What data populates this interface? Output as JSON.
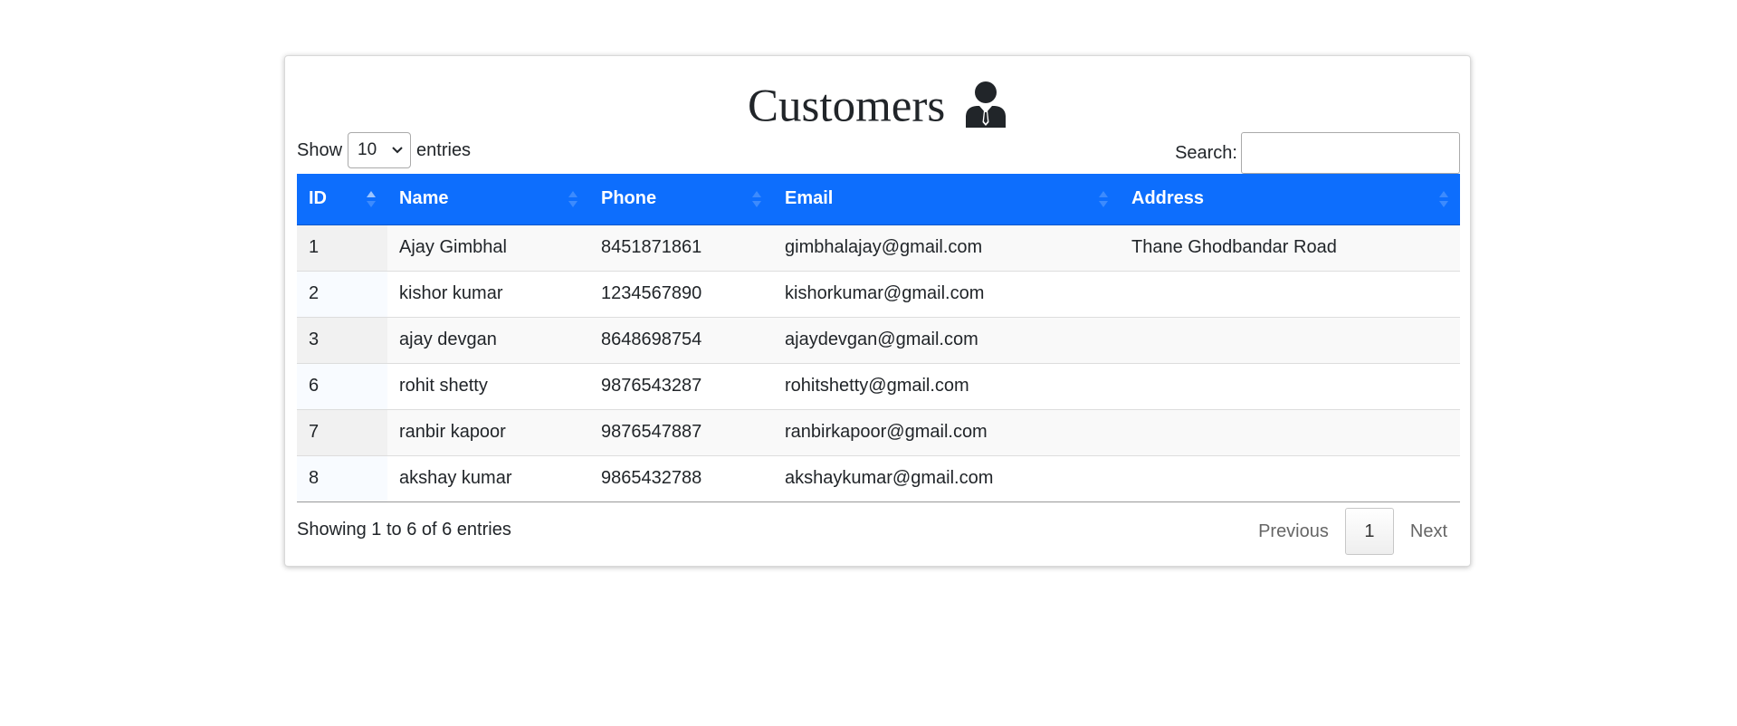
{
  "page": {
    "title": "Customers",
    "title_icon": "user-tie-icon"
  },
  "controls": {
    "show_label": "Show",
    "page_length": "10",
    "entries_label": "entries",
    "search_label": "Search:",
    "search_value": ""
  },
  "table": {
    "columns": [
      "ID",
      "Name",
      "Phone",
      "Email",
      "Address"
    ],
    "sorted_column": "ID",
    "sort_direction": "ascending",
    "rows": [
      {
        "id": "1",
        "name": "Ajay Gimbhal",
        "phone": "8451871861",
        "email": "gimbhalajay@gmail.com",
        "address": "Thane Ghodbandar Road"
      },
      {
        "id": "2",
        "name": "kishor kumar",
        "phone": "1234567890",
        "email": "kishorkumar@gmail.com",
        "address": ""
      },
      {
        "id": "3",
        "name": "ajay devgan",
        "phone": "8648698754",
        "email": "ajaydevgan@gmail.com",
        "address": ""
      },
      {
        "id": "6",
        "name": "rohit shetty",
        "phone": "9876543287",
        "email": "rohitshetty@gmail.com",
        "address": ""
      },
      {
        "id": "7",
        "name": "ranbir kapoor",
        "phone": "9876547887",
        "email": "ranbirkapoor@gmail.com",
        "address": ""
      },
      {
        "id": "8",
        "name": "akshay kumar",
        "phone": "9865432788",
        "email": "akshaykumar@gmail.com",
        "address": ""
      }
    ]
  },
  "footer": {
    "info": "Showing 1 to 6 of 6 entries",
    "previous_label": "Previous",
    "current_page": "1",
    "next_label": "Next"
  },
  "colors": {
    "header_bg": "#0d6efd",
    "header_text": "#ffffff"
  }
}
